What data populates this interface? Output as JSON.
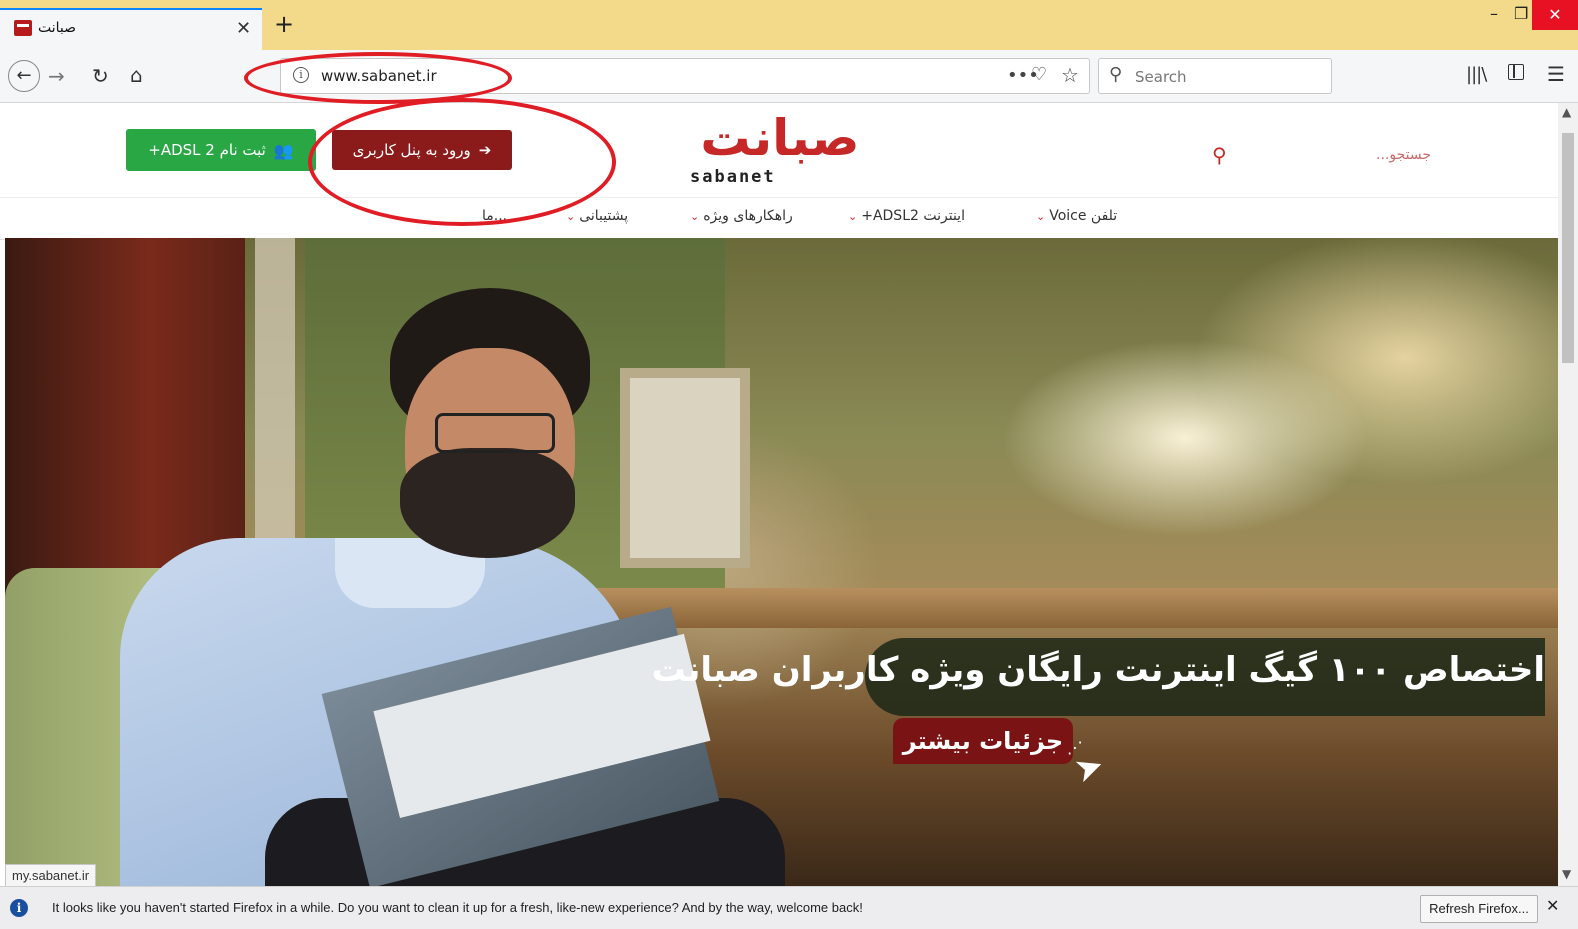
{
  "browser": {
    "tab_title": "صبانت",
    "url": "www.sabanet.ir",
    "search_placeholder": "Search",
    "page_actions_label": "•••"
  },
  "header": {
    "register_label": "ثبت نام ADSL 2+",
    "login_label": "ورود به پنل کاربری",
    "logo_text_fa": "صبانت",
    "logo_text_en": "sabanet",
    "search_placeholder": "جستجو..."
  },
  "nav": {
    "items": [
      {
        "label": "تلفن Voice"
      },
      {
        "label": "اینترنت ADSL2+"
      },
      {
        "label": "راهکارهای ویژه"
      },
      {
        "label": "پشتیبانی"
      },
      {
        "label": "...ما"
      }
    ]
  },
  "hero": {
    "headline": "اختصاص ۱۰۰ گیگ اینترنت رایگان ویژه کاربران صبانت",
    "details_label": "جزئیات بیشتر"
  },
  "status_link": "my.sabanet.ir",
  "notification": {
    "text": "It looks like you haven't started Firefox in a while. Do you want to clean it up for a fresh, like-new experience? And by the way, welcome back!",
    "refresh_label": "Refresh Firefox..."
  },
  "colors": {
    "brand_red": "#c62828",
    "login_button": "#8b1a1a",
    "register_button": "#2aa745",
    "annotation_circle": "#e01c24",
    "tab_strip": "#f3d98a"
  },
  "icons": {
    "back": "arrow-left-icon",
    "forward": "arrow-right-icon",
    "reload": "reload-icon",
    "home": "home-icon",
    "info": "info-icon",
    "pocket": "pocket-icon",
    "bookmark": "star-icon",
    "search": "search-icon",
    "library": "library-icon",
    "sidebar": "sidebar-icon",
    "menu": "hamburger-menu-icon",
    "umbrella": "umbrella-icon"
  }
}
